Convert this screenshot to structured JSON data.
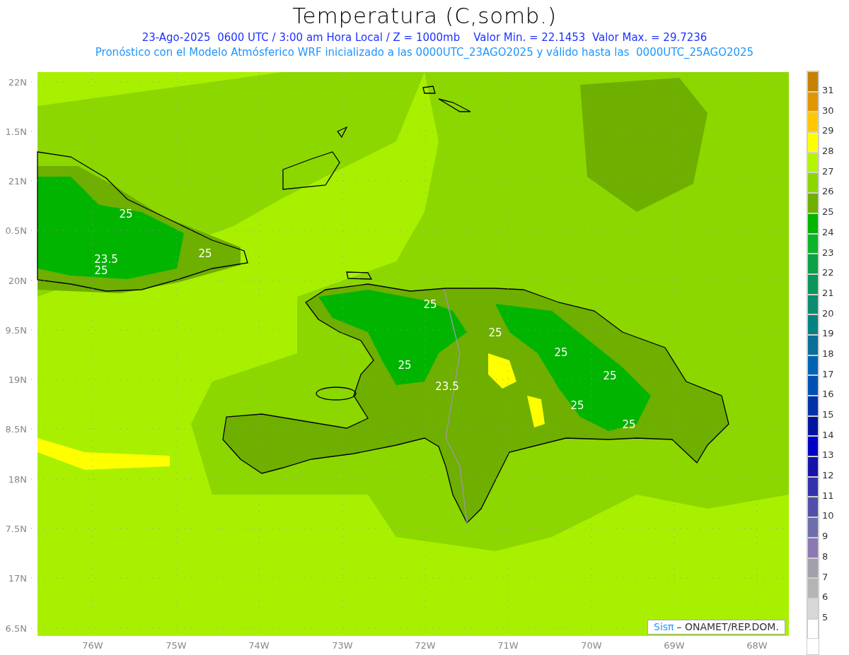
{
  "header": {
    "title": "Temperatura (C,somb.)",
    "subtitle": "23-Ago-2025  0600 UTC / 3:00 am Hora Local / Z = 1000mb    Valor Min. = 22.1453  Valor Max. = 29.7236",
    "forecast_note": "Pronóstico con el Modelo Atmósferico WRF inicializado a las 0000UTC_23AGO2025 y válido hasta las  0000UTC_25AGO2025"
  },
  "map": {
    "lat_labels": [
      "22N",
      "1.5N",
      "21N",
      "0.5N",
      "20N",
      "9.5N",
      "19N",
      "8.5N",
      "18N",
      "7.5N",
      "17N",
      "6.5N"
    ],
    "lon_labels": [
      "76W",
      "75W",
      "74W",
      "73W",
      "72W",
      "71W",
      "70W",
      "69W",
      "68W"
    ],
    "contour_labels": [
      "25",
      "25",
      "23.5",
      "25",
      "25",
      "25",
      "25",
      "25",
      "23.5",
      "25",
      "25",
      "25"
    ],
    "credit": {
      "brand": "Sisπ",
      "text": "– ONAMET/REP.DOM."
    }
  },
  "colorbar": {
    "bins": [
      {
        "color": "#c88000"
      },
      {
        "color": "#e19600"
      },
      {
        "color": "#ffc800"
      },
      {
        "color": "#ffff00"
      },
      {
        "color": "#b4f500"
      },
      {
        "color": "#8cd700"
      },
      {
        "color": "#6eaf00"
      },
      {
        "color": "#00b400"
      },
      {
        "color": "#0cb428"
      },
      {
        "color": "#0aa046"
      },
      {
        "color": "#08965a"
      },
      {
        "color": "#0a8c6e"
      },
      {
        "color": "#008282"
      },
      {
        "color": "#0a6e96"
      },
      {
        "color": "#0064b4"
      },
      {
        "color": "#0050b4"
      },
      {
        "color": "#0032aa"
      },
      {
        "color": "#0014a0"
      },
      {
        "color": "#0000c8"
      },
      {
        "color": "#1414aa"
      },
      {
        "color": "#3232aa"
      },
      {
        "color": "#5050aa"
      },
      {
        "color": "#6e6eaa"
      },
      {
        "color": "#8c78b4"
      },
      {
        "color": "#a0a0aa"
      },
      {
        "color": "#b4b4b4"
      },
      {
        "color": "#d7d7d7"
      },
      {
        "color": "#ffffff"
      }
    ],
    "labels": [
      "31",
      "30",
      "29",
      "28",
      "27",
      "26",
      "25",
      "24",
      "23",
      "22",
      "21",
      "20",
      "19",
      "18",
      "17",
      "16",
      "15",
      "14",
      "13",
      "12",
      "11",
      "10",
      "9",
      "8",
      "7",
      "6",
      "5"
    ]
  }
}
